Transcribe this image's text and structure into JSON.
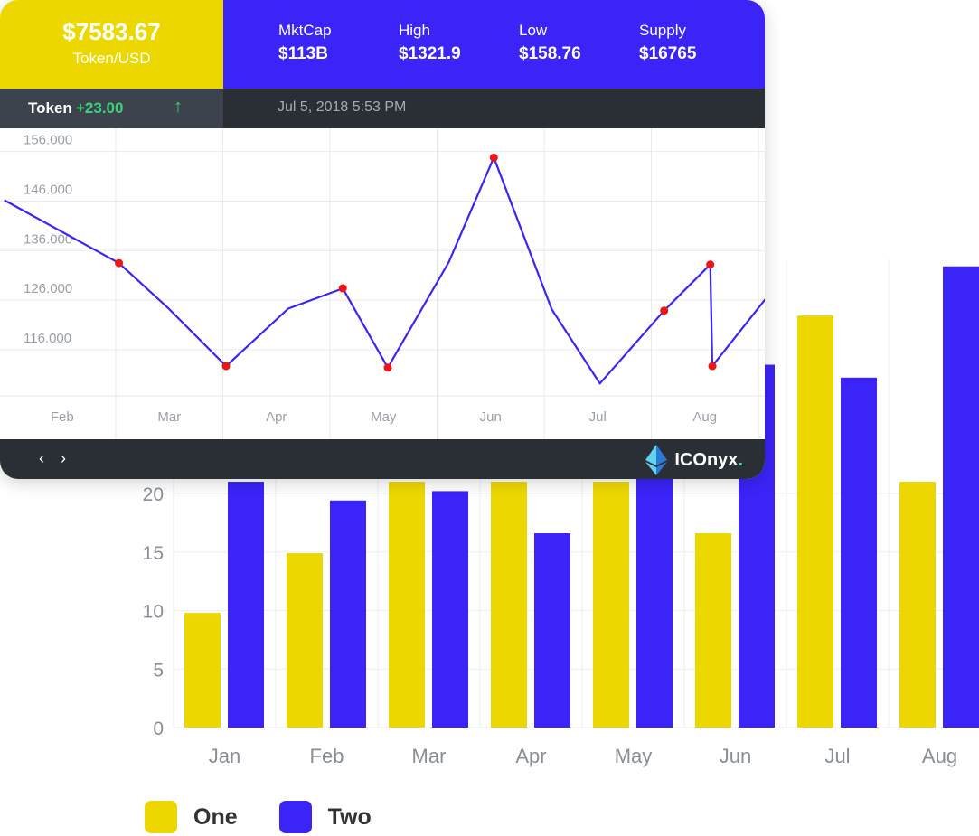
{
  "colors": {
    "yellow": "#ecd800",
    "blue": "#3a24f7",
    "dark": "#2a2f36",
    "green": "#3ed17a",
    "red": "#f01414"
  },
  "header": {
    "price": "$7583.67",
    "unit": "Token/USD",
    "stats": [
      {
        "label": "MktCap",
        "value": "$113B"
      },
      {
        "label": "High",
        "value": "$1321.9"
      },
      {
        "label": "Low",
        "value": "$158.76"
      },
      {
        "label": "Supply",
        "value": "$16765"
      }
    ]
  },
  "ticker": {
    "name": "Token",
    "change": "+23.00",
    "arrow_icon": "arrow-up-icon",
    "timestamp": "Jul 5, 2018 5:53 PM"
  },
  "footer": {
    "prev_label": "‹",
    "next_label": "›",
    "brand": "ICOnyx",
    "brand_suffix": "."
  },
  "chart_data": [
    {
      "type": "line",
      "y_tick_labels": [
        "156.000",
        "146.000",
        "136.000",
        "126.000",
        "116.000"
      ],
      "y_ticks": [
        156,
        146,
        136,
        126,
        116
      ],
      "categories": [
        "Feb",
        "Mar",
        "Apr",
        "May",
        "Jun",
        "Jul",
        "Aug"
      ],
      "ylim": [
        106.5,
        160.5
      ],
      "x": [
        -0.54,
        0.53,
        1.0,
        1.53,
        2.11,
        2.62,
        3.04,
        3.61,
        4.03,
        4.57,
        5.02,
        5.62,
        6.05,
        6.07,
        7.14
      ],
      "values": [
        146.0,
        133.3,
        124.0,
        112.5,
        124.1,
        128.2,
        112.2,
        133.5,
        154.6,
        124.0,
        109.0,
        123.7,
        133.0,
        112.5,
        141.7
      ],
      "markers": [
        1,
        3,
        5,
        6,
        8,
        11,
        12,
        13
      ],
      "grid": true
    },
    {
      "type": "bar",
      "categories": [
        "Jan",
        "Feb",
        "Mar",
        "Apr",
        "May",
        "Jun",
        "Jul",
        "Aug"
      ],
      "ylim": [
        0,
        40
      ],
      "y_ticks": [
        0,
        5,
        10,
        15,
        20
      ],
      "series": [
        {
          "name": "One",
          "values": [
            9.8,
            14.9,
            21,
            21,
            21,
            16.6,
            35.2,
            21
          ]
        },
        {
          "name": "Two",
          "values": [
            21,
            19.4,
            20.2,
            16.6,
            31,
            31,
            29.9,
            39.4
          ]
        }
      ],
      "legend": "bottom-left",
      "grid": true
    }
  ]
}
